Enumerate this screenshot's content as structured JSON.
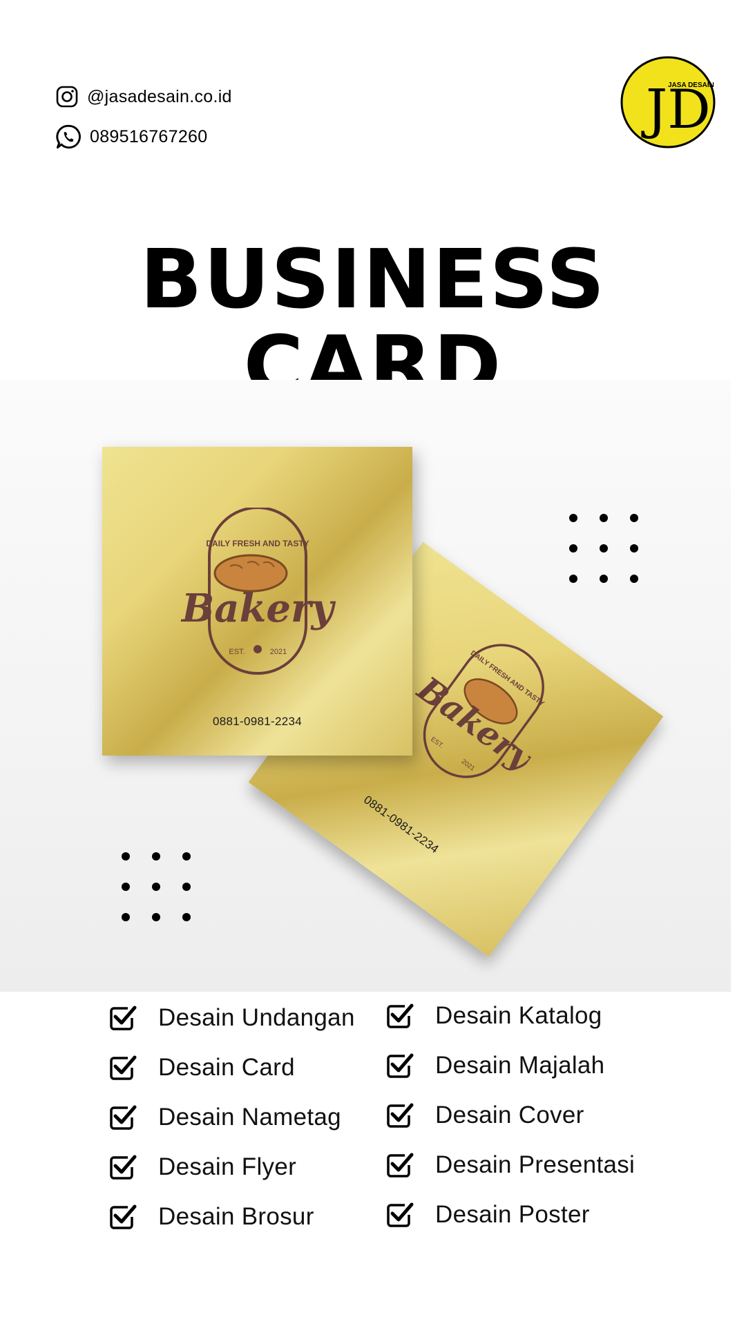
{
  "contact": {
    "instagram": "@jasadesain.co.id",
    "phone": "089516767260"
  },
  "logo": {
    "monogram": "JD",
    "text": "JASA DESAIN",
    "color": "#f1e21b"
  },
  "title": {
    "line1": "BUSINESS",
    "line2": "CARD"
  },
  "cards": {
    "brand": "Bakery",
    "tagline": "DAILY FRESH AND TASTY",
    "est": "EST.",
    "year": "2021",
    "phone": "0881-0981-2234"
  },
  "services": {
    "left": [
      "Desain Undangan",
      "Desain Card",
      "Desain Nametag",
      "Desain Flyer",
      "Desain Brosur"
    ],
    "right": [
      "Desain Katalog",
      "Desain Majalah",
      "Desain Cover",
      "Desain Presentasi",
      "Desain Poster"
    ]
  },
  "icons": {
    "instagram": "instagram-icon",
    "whatsapp": "whatsapp-icon",
    "check": "checkbox-checked-icon"
  },
  "colors": {
    "gold": "#e4d27a",
    "brown": "#6b3f3a",
    "bread": "#c9853d"
  }
}
